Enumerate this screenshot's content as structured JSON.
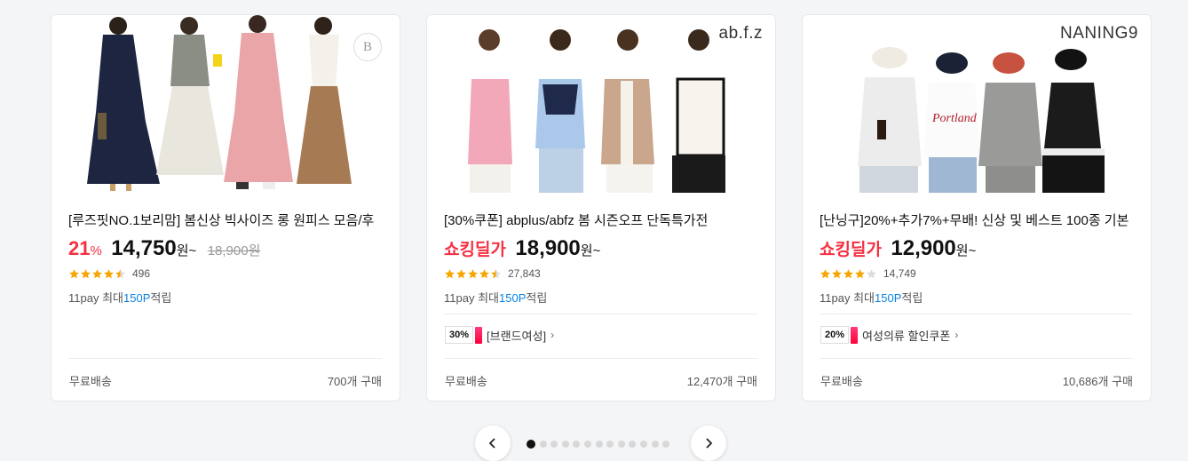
{
  "colors": {
    "accent": "#f43142",
    "point_blue": "#0b83e6",
    "star": "#f7a500"
  },
  "products": [
    {
      "brand_badge": "B",
      "brand_text": "",
      "title": "[루즈핏NO.1보리맘] 봄신상 빅사이즈 롱 원피스 모음/후",
      "discount": "21",
      "discount_unit": "%",
      "price": "14,750",
      "won": "원~",
      "original_price": "18,900원",
      "rating": 4.5,
      "review_count": "496",
      "points_prefix": "11pay 최대",
      "points_value": "150P",
      "points_suffix": "적립",
      "shipping": "무료배송",
      "purchases": "700개 구매"
    },
    {
      "brand_text": "ab.f.z",
      "title": "[30%쿠폰] abplus/abfz 봄 시즌오프 단독특가전",
      "tag": "쇼킹딜가",
      "price": "18,900",
      "won": "원~",
      "rating": 4.5,
      "review_count": "27,843",
      "points_prefix": "11pay 최대",
      "points_value": "150P",
      "points_suffix": "적립",
      "coupon_pct": "30%",
      "coupon_text": "[브랜드여성]",
      "shipping": "무료배송",
      "purchases": "12,470개 구매"
    },
    {
      "brand_text": "NANING9",
      "title": "[난닝구]20%+추가7%+무배! 신상 및 베스트 100종 기본",
      "tag": "쇼킹딜가",
      "price": "12,900",
      "won": "원~",
      "rating": 4,
      "review_count": "14,749",
      "points_prefix": "11pay 최대",
      "points_value": "150P",
      "points_suffix": "적립",
      "coupon_pct": "20%",
      "coupon_text": "여성의류 할인쿠폰",
      "shipping": "무료배송",
      "purchases": "10,686개 구매"
    }
  ],
  "carousel": {
    "prev_icon": "chevron-left-icon",
    "next_icon": "chevron-right-icon",
    "page_count": 13,
    "active_page": 1
  }
}
